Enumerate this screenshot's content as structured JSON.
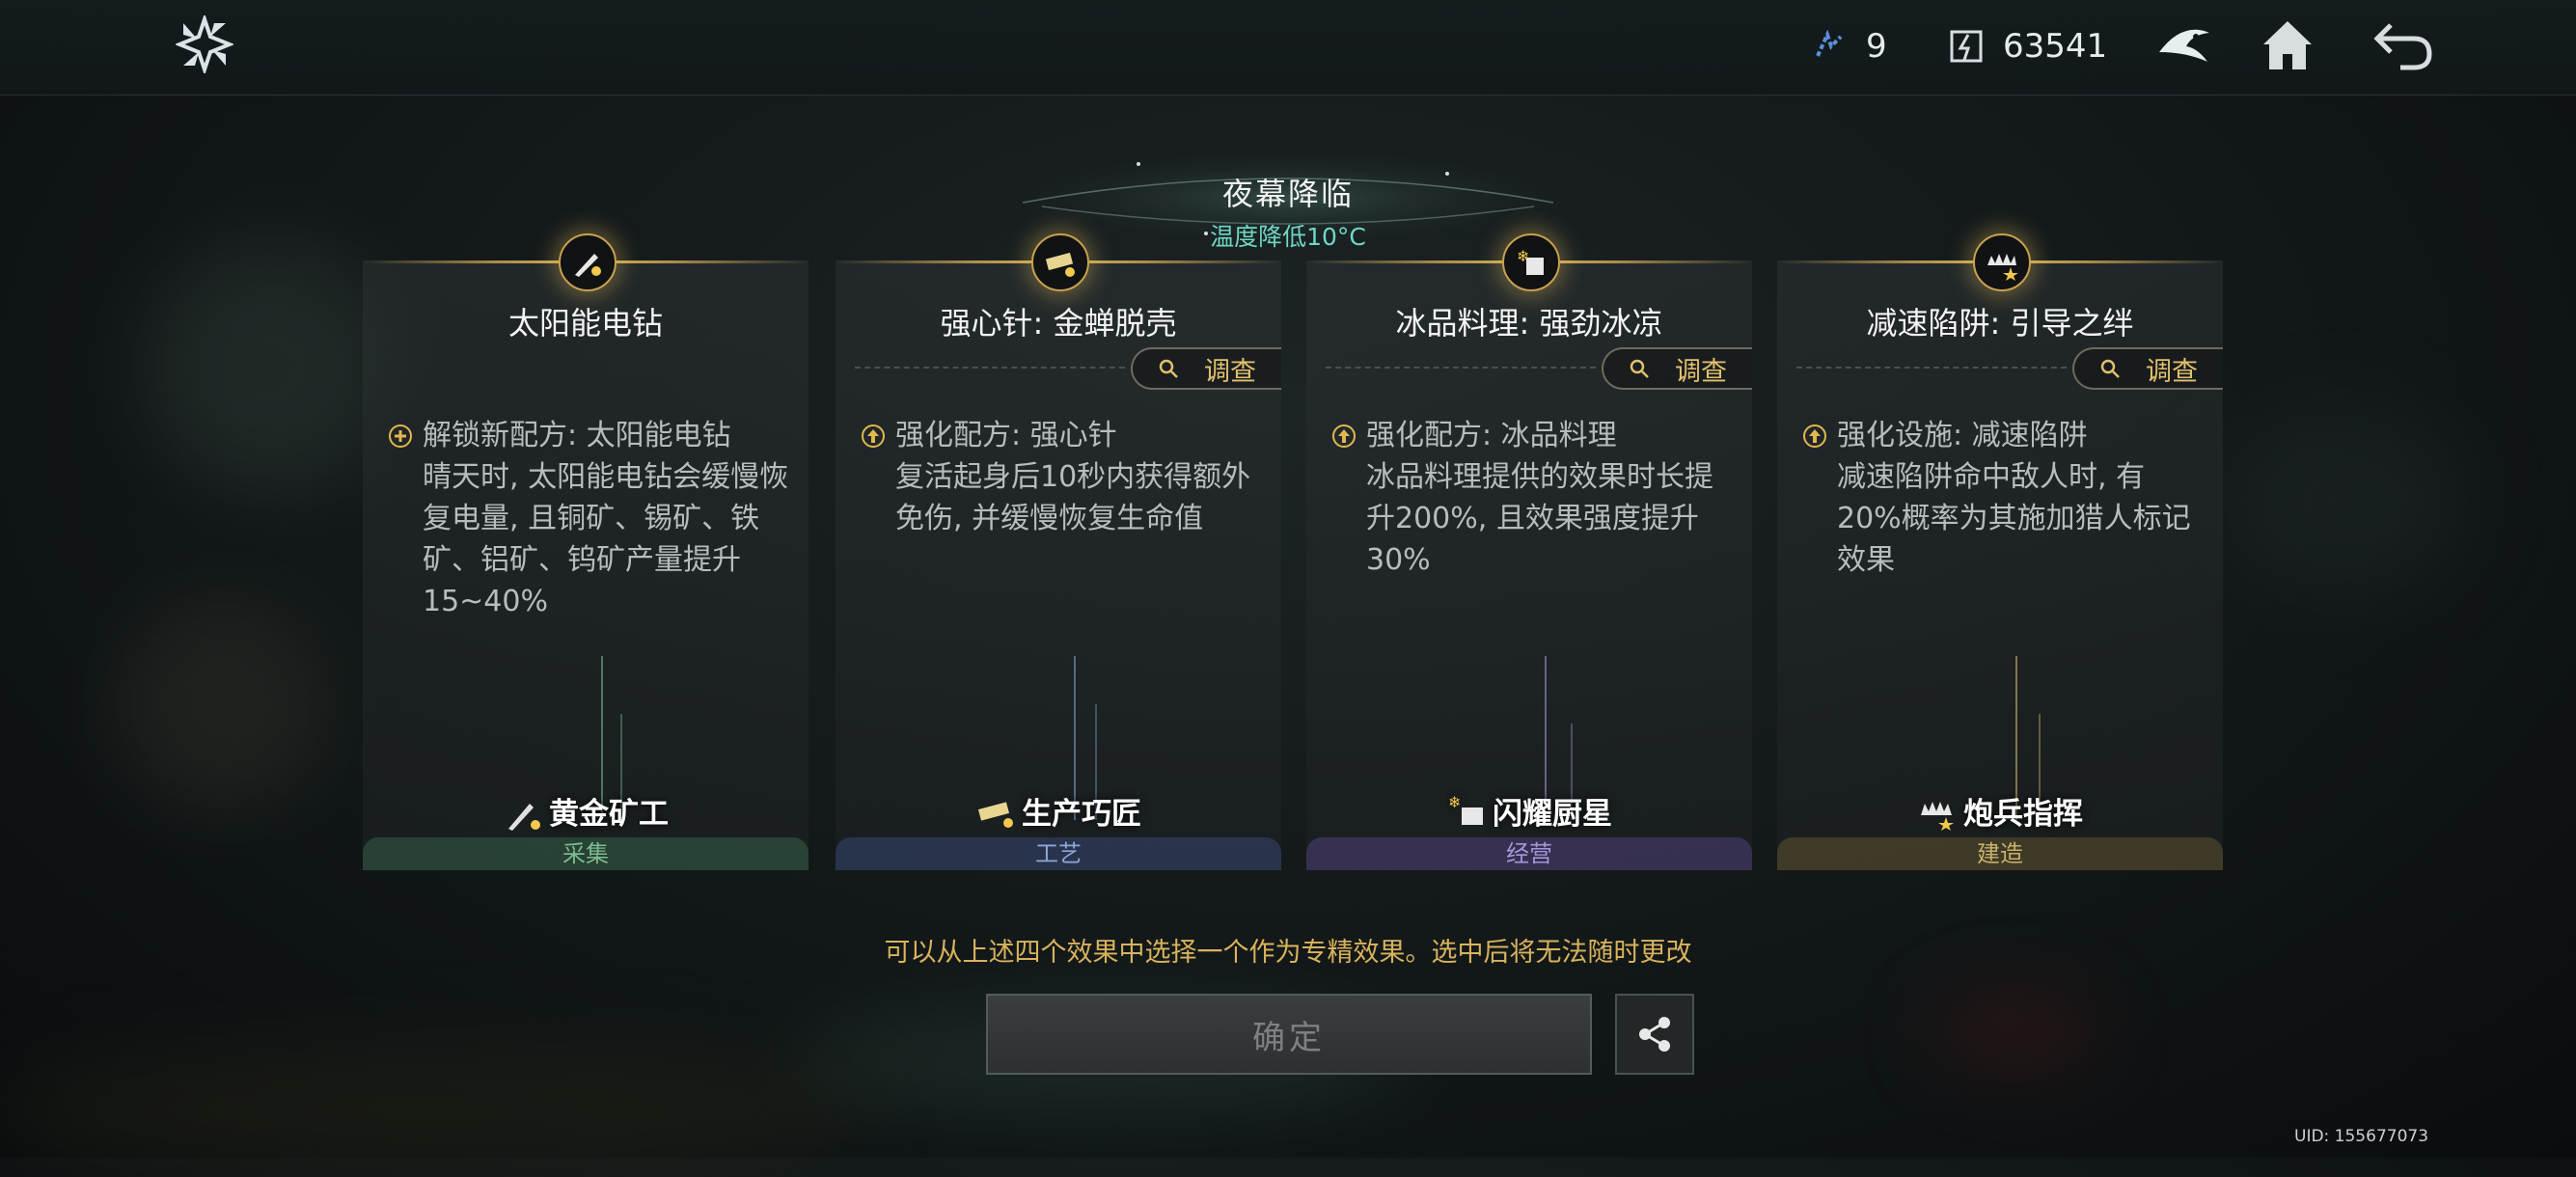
{
  "topbar": {
    "resource_1": {
      "icon": "energy-icon",
      "value": "9"
    },
    "resource_2": {
      "icon": "currency-icon",
      "value": "63541"
    },
    "icons": [
      "faction-emblem-icon",
      "home-icon",
      "back-icon"
    ]
  },
  "event": {
    "title": "夜幕降临",
    "subtitle": "温度降低10°C"
  },
  "cards": [
    {
      "title": "太阳能电钻",
      "has_investigate": false,
      "effect_head": "解锁新配方: 太阳能电钻",
      "effect_body": "晴天时, 太阳能电钻会缓慢恢复电量, 且铜矿、锡矿、铁矿、铝矿、钨矿产量提升15~40%",
      "role": "黄金矿工",
      "category": "采集",
      "color": "#5fae7e"
    },
    {
      "title": "强心针: 金蝉脱壳",
      "has_investigate": true,
      "investigate_label": "调查",
      "effect_head": "强化配方: 强心针",
      "effect_body": "复活起身后10秒内获得额外免伤, 并缓慢恢复生命值",
      "role": "生产巧匠",
      "category": "工艺",
      "color": "#6f8ed0"
    },
    {
      "title": "冰品料理: 强劲冰凉",
      "has_investigate": true,
      "investigate_label": "调查",
      "effect_head": "强化配方: 冰品料理",
      "effect_body": "冰品料理提供的效果时长提升200%, 且效果强度提升30%",
      "role": "闪耀厨星",
      "category": "经营",
      "color": "#9a86d6"
    },
    {
      "title": "减速陷阱: 引导之绊",
      "has_investigate": true,
      "investigate_label": "调查",
      "effect_head": "强化设施: 减速陷阱",
      "effect_body": "减速陷阱命中敌人时, 有20%概率为其施加猎人标记效果",
      "role": "炮兵指挥",
      "category": "建造",
      "color": "#c9ad5a"
    }
  ],
  "hint": "可以从上述四个效果中选择一个作为专精效果。选中后将无法随时更改",
  "confirm_label": "确定",
  "uid": "UID: 155677073"
}
